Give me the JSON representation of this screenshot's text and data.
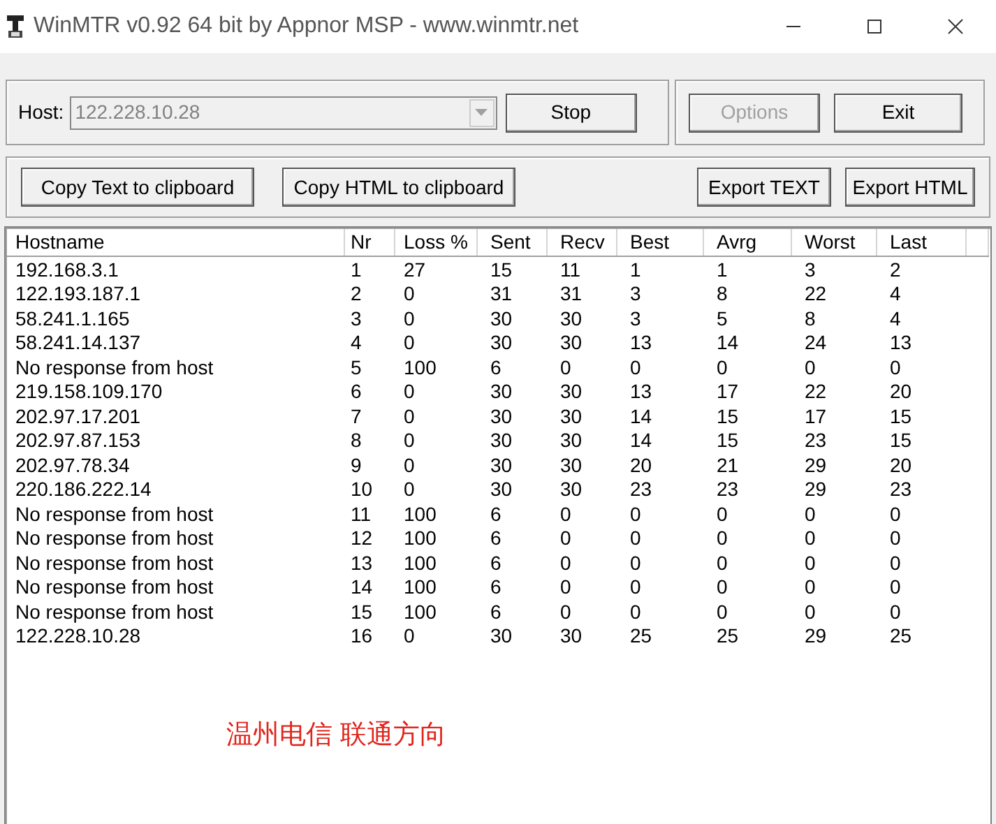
{
  "window": {
    "title": "WinMTR v0.92 64 bit by Appnor MSP - www.winmtr.net"
  },
  "host": {
    "label": "Host:",
    "value": "122.228.10.28",
    "disabled": true
  },
  "top_buttons": [
    {
      "label": "Stop",
      "disabled": false
    },
    {
      "label": "Options",
      "disabled": true
    },
    {
      "label": "Exit",
      "disabled": false
    }
  ],
  "export_buttons": [
    {
      "label": "Copy Text to clipboard"
    },
    {
      "label": "Copy HTML to clipboard"
    },
    {
      "label": "Export TEXT"
    },
    {
      "label": "Export HTML"
    }
  ],
  "table": {
    "columns": [
      "Hostname",
      "Nr",
      "Loss %",
      "Sent",
      "Recv",
      "Best",
      "Avrg",
      "Worst",
      "Last"
    ],
    "rows": [
      [
        "192.168.3.1",
        "1",
        "27",
        "15",
        "11",
        "1",
        "1",
        "3",
        "2"
      ],
      [
        "122.193.187.1",
        "2",
        "0",
        "31",
        "31",
        "3",
        "8",
        "22",
        "4"
      ],
      [
        "58.241.1.165",
        "3",
        "0",
        "30",
        "30",
        "3",
        "5",
        "8",
        "4"
      ],
      [
        "58.241.14.137",
        "4",
        "0",
        "30",
        "30",
        "13",
        "14",
        "24",
        "13"
      ],
      [
        "No response from host",
        "5",
        "100",
        "6",
        "0",
        "0",
        "0",
        "0",
        "0"
      ],
      [
        "219.158.109.170",
        "6",
        "0",
        "30",
        "30",
        "13",
        "17",
        "22",
        "20"
      ],
      [
        "202.97.17.201",
        "7",
        "0",
        "30",
        "30",
        "14",
        "15",
        "17",
        "15"
      ],
      [
        "202.97.87.153",
        "8",
        "0",
        "30",
        "30",
        "14",
        "15",
        "23",
        "15"
      ],
      [
        "202.97.78.34",
        "9",
        "0",
        "30",
        "30",
        "20",
        "21",
        "29",
        "20"
      ],
      [
        "220.186.222.14",
        "10",
        "0",
        "30",
        "30",
        "23",
        "23",
        "29",
        "23"
      ],
      [
        "No response from host",
        "11",
        "100",
        "6",
        "0",
        "0",
        "0",
        "0",
        "0"
      ],
      [
        "No response from host",
        "12",
        "100",
        "6",
        "0",
        "0",
        "0",
        "0",
        "0"
      ],
      [
        "No response from host",
        "13",
        "100",
        "6",
        "0",
        "0",
        "0",
        "0",
        "0"
      ],
      [
        "No response from host",
        "14",
        "100",
        "6",
        "0",
        "0",
        "0",
        "0",
        "0"
      ],
      [
        "No response from host",
        "15",
        "100",
        "6",
        "0",
        "0",
        "0",
        "0",
        "0"
      ],
      [
        "122.228.10.28",
        "16",
        "0",
        "30",
        "30",
        "25",
        "25",
        "29",
        "25"
      ]
    ]
  },
  "annotation": "温州电信 联通方向"
}
